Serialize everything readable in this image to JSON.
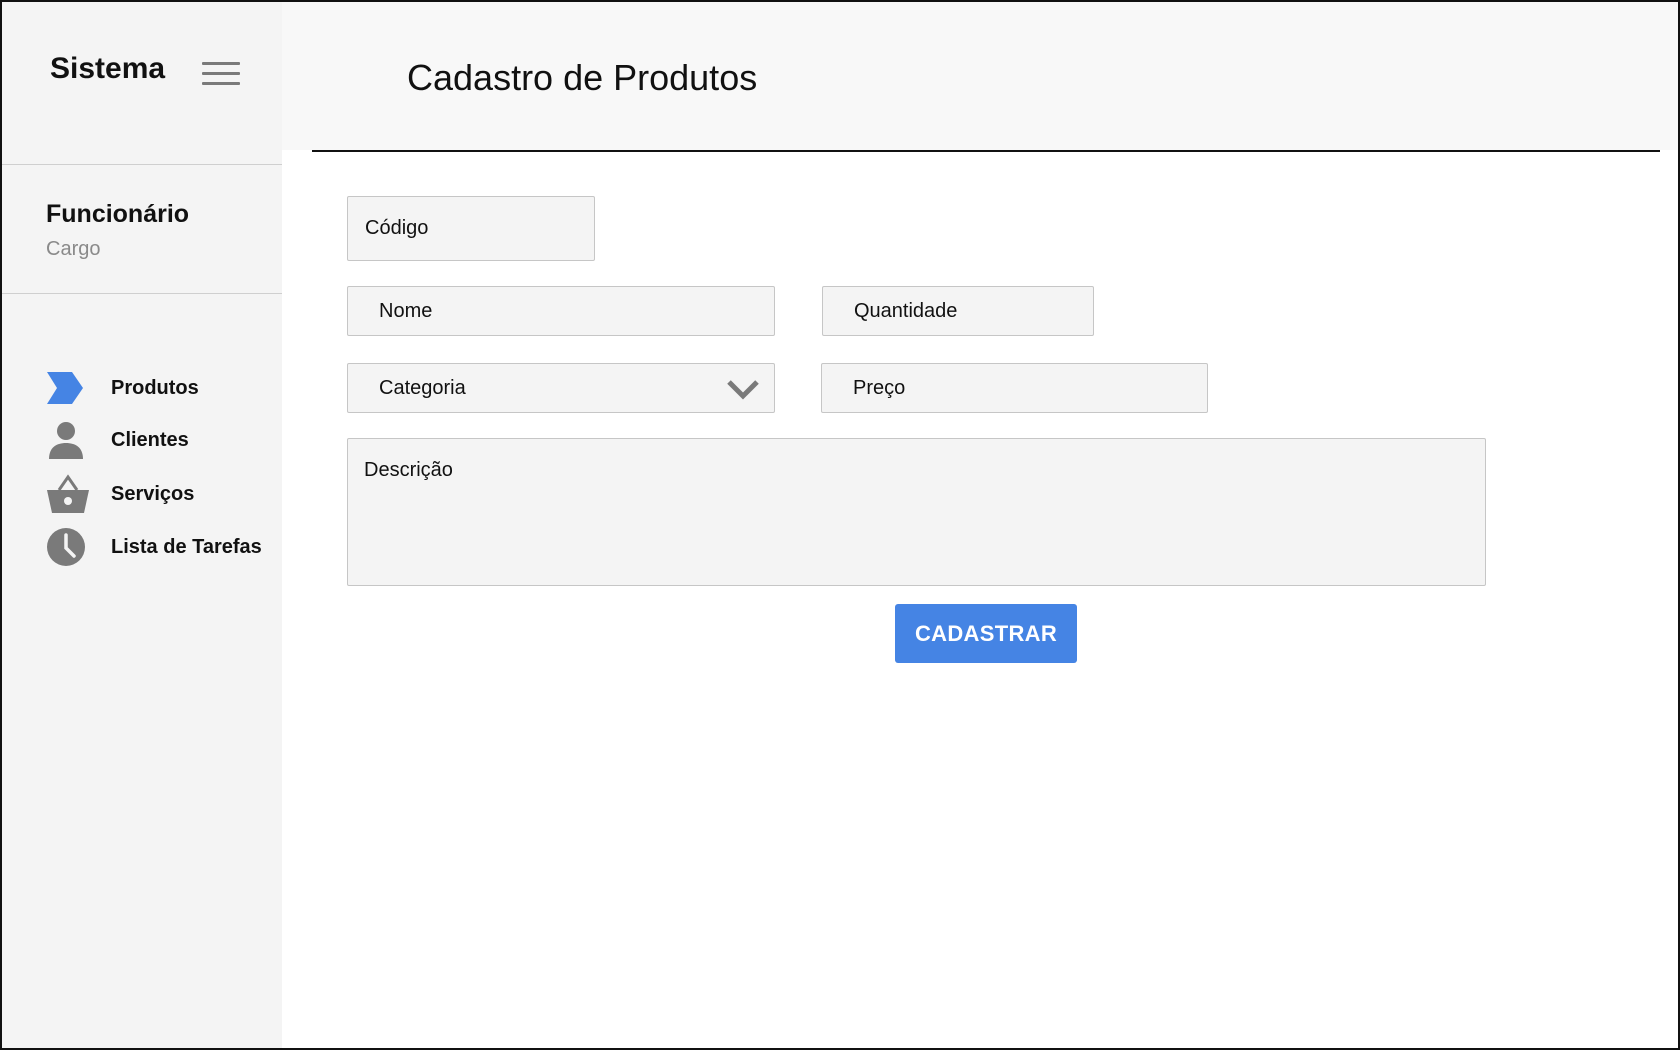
{
  "sidebar": {
    "brand": "Sistema",
    "menu_icon": "hamburger-menu-icon",
    "user": {
      "name": "Funcionário",
      "role": "Cargo"
    },
    "items": [
      {
        "label": "Produtos",
        "icon": "chevron-right-arrow-icon",
        "active": true
      },
      {
        "label": "Clientes",
        "icon": "person-icon",
        "active": false
      },
      {
        "label": "Serviços",
        "icon": "shopping-basket-icon",
        "active": false
      },
      {
        "label": "Lista de Tarefas",
        "icon": "clock-icon",
        "active": false
      }
    ]
  },
  "header": {
    "title": "Cadastro de Produtos"
  },
  "form": {
    "codigo": {
      "placeholder": "Código",
      "value": ""
    },
    "nome": {
      "placeholder": "Nome",
      "value": ""
    },
    "quantidade": {
      "placeholder": "Quantidade",
      "value": ""
    },
    "categoria": {
      "selected": "Categoria"
    },
    "preco": {
      "placeholder": "Preço",
      "value": ""
    },
    "descricao": {
      "placeholder": "Descrição",
      "value": ""
    },
    "submit_label": "CADASTRAR"
  },
  "colors": {
    "accent": "#4584e4",
    "sidebar_bg": "#f4f4f4",
    "header_bg": "#f8f8f8",
    "field_bg": "#f4f4f4",
    "icon_gray": "#7a7a7a"
  }
}
